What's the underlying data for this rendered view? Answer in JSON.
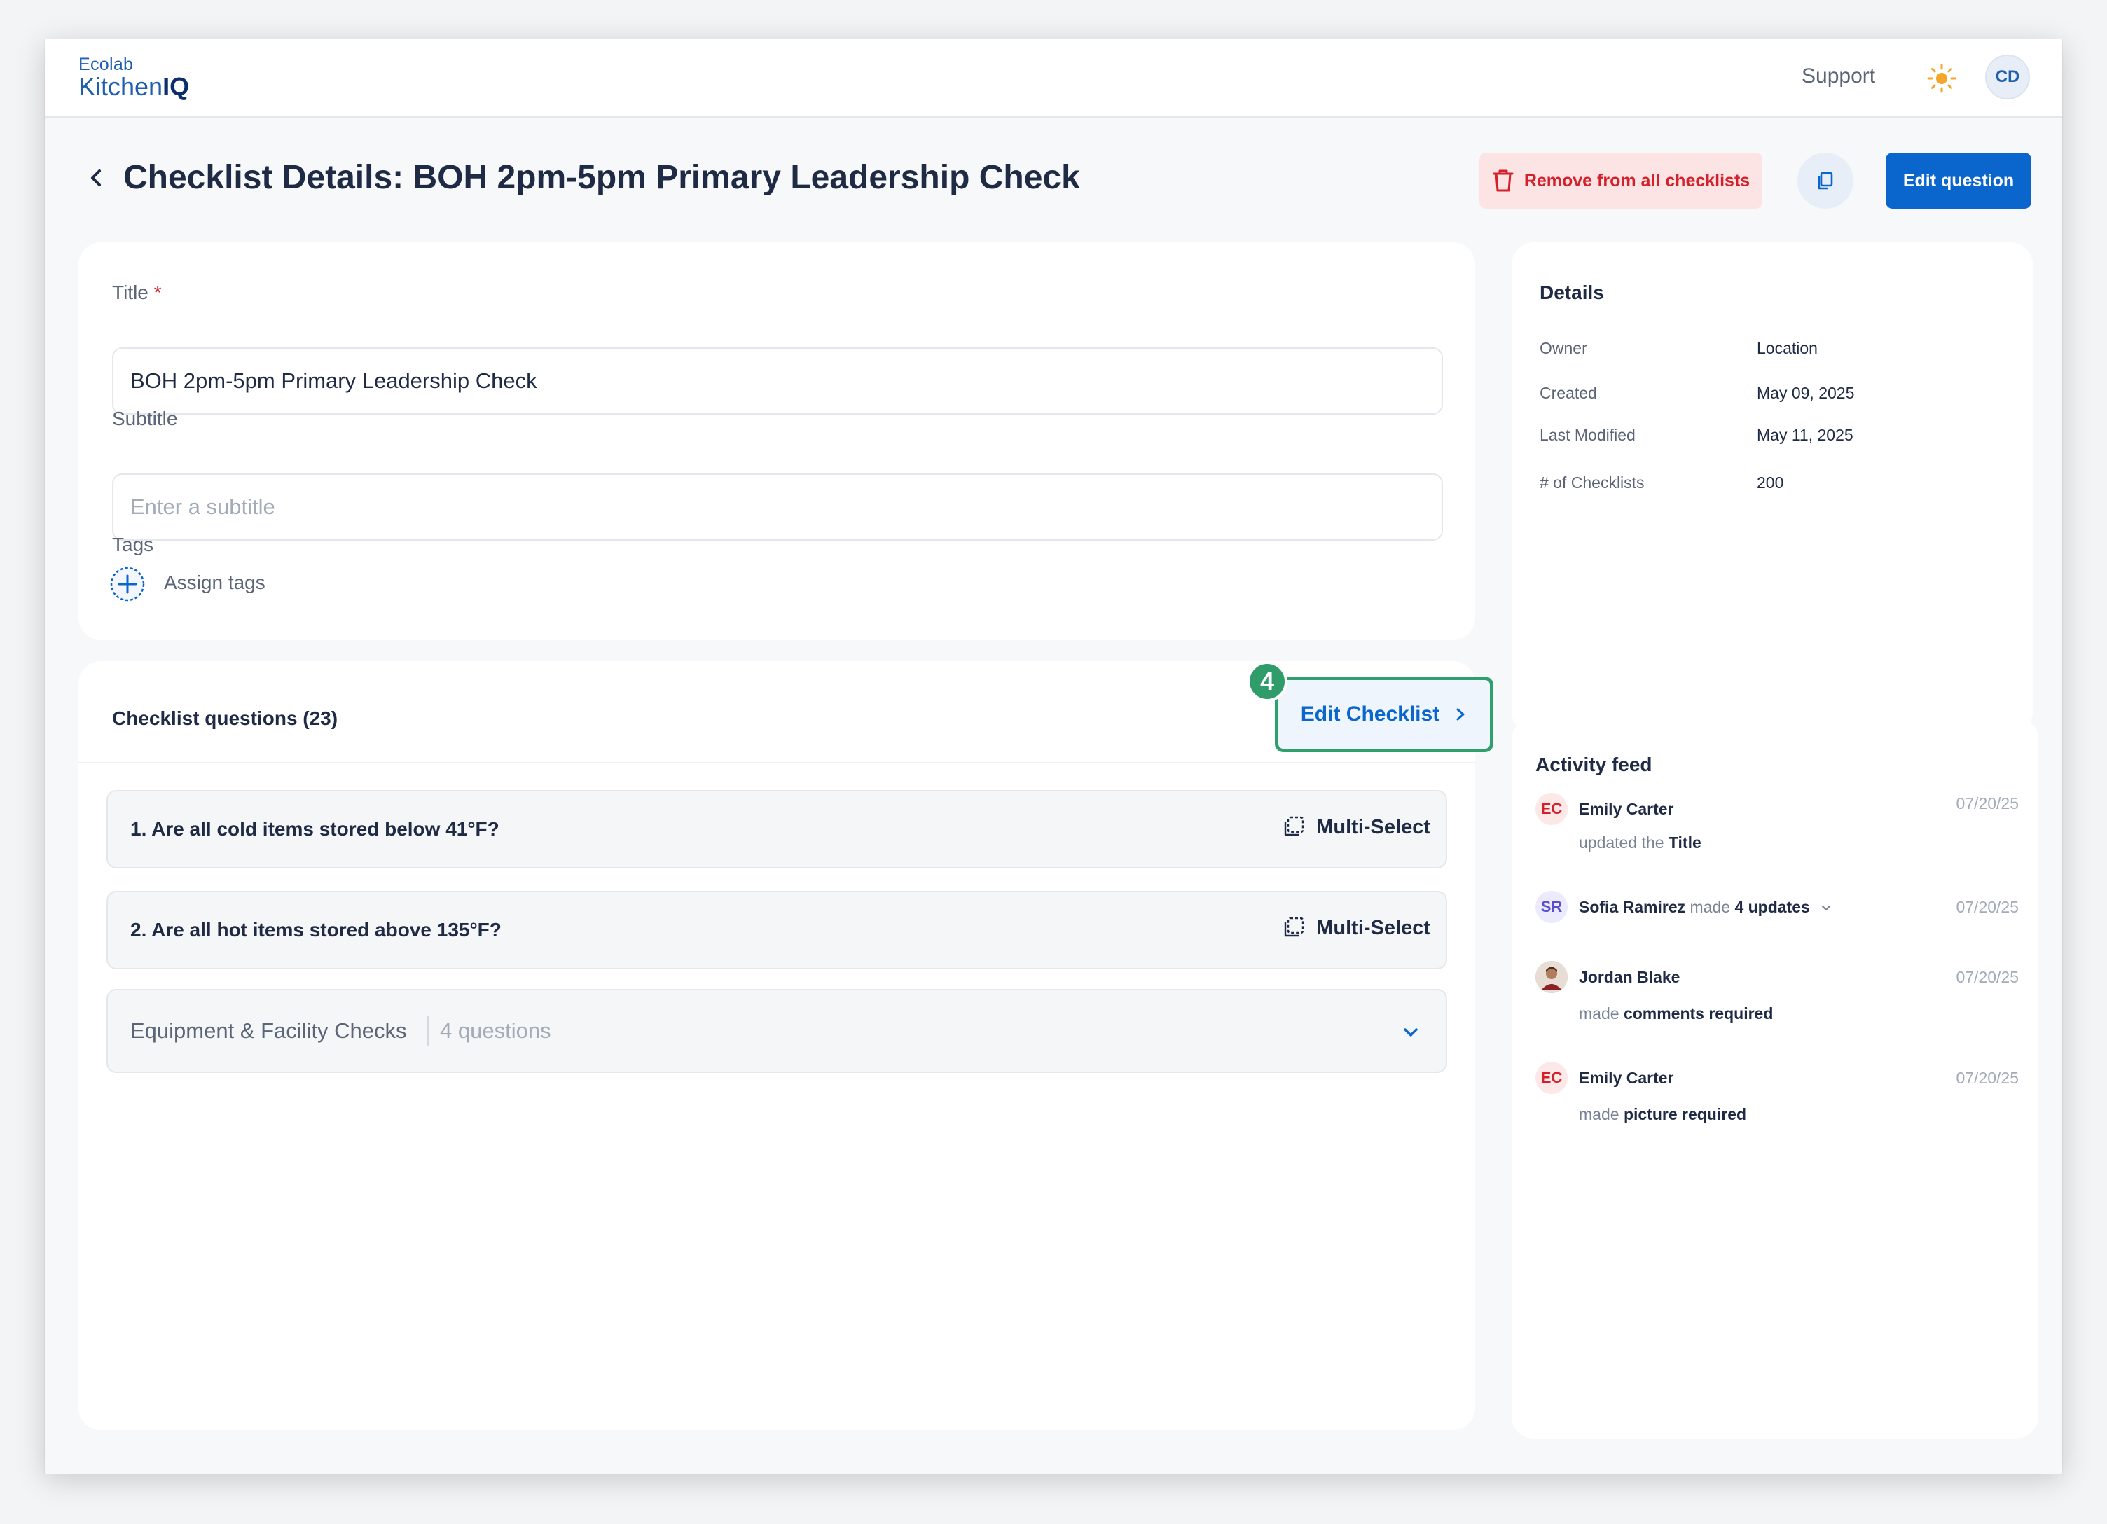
{
  "app": {
    "logo_brand": "Ecolab",
    "logo_product_prefix": "Kitchen",
    "logo_product_suffix": "IQ",
    "support_label": "Support",
    "user_initials": "CD"
  },
  "header": {
    "title": "Checklist Details: BOH 2pm-5pm Primary Leadership Check",
    "remove_label": "Remove from all checklists",
    "edit_question_label": "Edit question"
  },
  "form": {
    "title_label": "Title",
    "title_required_mark": "*",
    "title_value": "BOH 2pm-5pm Primary Leadership Check",
    "subtitle_label": "Subtitle",
    "subtitle_placeholder": "Enter a subtitle",
    "tags_label": "Tags",
    "assign_tags_label": "Assign tags"
  },
  "questions": {
    "header": "Checklist questions (23)",
    "edit_checklist_label": "Edit Checklist",
    "step_badge": "4",
    "items": [
      {
        "text": "1. Are all cold items stored below 41°F?",
        "type": "Multi-Select"
      },
      {
        "text": "2. Are all hot items stored above 135°F?",
        "type": "Multi-Select"
      }
    ],
    "section": {
      "title": "Equipment & Facility Checks",
      "count": "4 questions"
    }
  },
  "details": {
    "title": "Details",
    "rows": [
      {
        "key": "Owner",
        "value": "Location"
      },
      {
        "key": "Created",
        "value": "May 09, 2025"
      },
      {
        "key": "Last Modified",
        "value": "May 11, 2025"
      },
      {
        "key": "# of Checklists",
        "value": "200"
      }
    ]
  },
  "activity": {
    "title": "Activity feed",
    "items": [
      {
        "initials": "EC",
        "name": "Emily Carter",
        "sub_prefix": "updated the",
        "sub_bold": "Title",
        "date": "07/20/25"
      },
      {
        "initials": "SR",
        "name": "Sofia Ramirez",
        "name_mute": "made",
        "name_bold": "4 updates",
        "date": "07/20/25"
      },
      {
        "initials": "",
        "name": "Jordan Blake",
        "sub_prefix": "made",
        "sub_bold": "comments required",
        "date": "07/20/25"
      },
      {
        "initials": "EC",
        "name": "Emily Carter",
        "sub_prefix": "made",
        "sub_bold": "picture required",
        "date": "07/20/25"
      }
    ]
  },
  "colors": {
    "primary": "#0a66cc",
    "danger": "#d3202a",
    "highlight_green": "#2fa06b"
  }
}
